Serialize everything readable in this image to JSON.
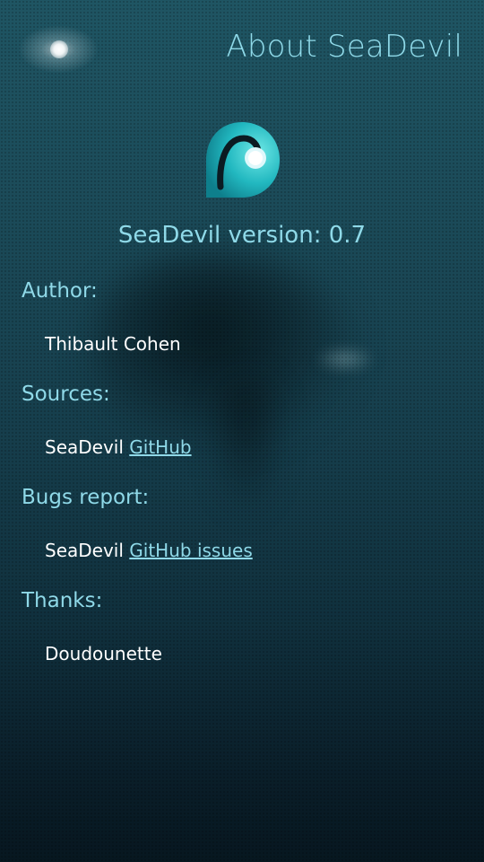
{
  "page": {
    "title": "About SeaDevil"
  },
  "app": {
    "version_line": "SeaDevil version: 0.7",
    "logo_icon": "seadevil-logo-icon"
  },
  "sections": {
    "author": {
      "heading": "Author:",
      "value": "Thibault Cohen"
    },
    "sources": {
      "heading": "Sources:",
      "prefix": "SeaDevil",
      "link_text": "GitHub"
    },
    "bugs": {
      "heading": "Bugs report:",
      "prefix": "SeaDevil",
      "link_text": "GitHub issues"
    },
    "thanks": {
      "heading": "Thanks:",
      "value": "Doudounette"
    }
  },
  "colors": {
    "accent": "#8fd9e8",
    "text": "#ffffff",
    "background_top": "#1f5563",
    "background_bottom": "#071720"
  }
}
